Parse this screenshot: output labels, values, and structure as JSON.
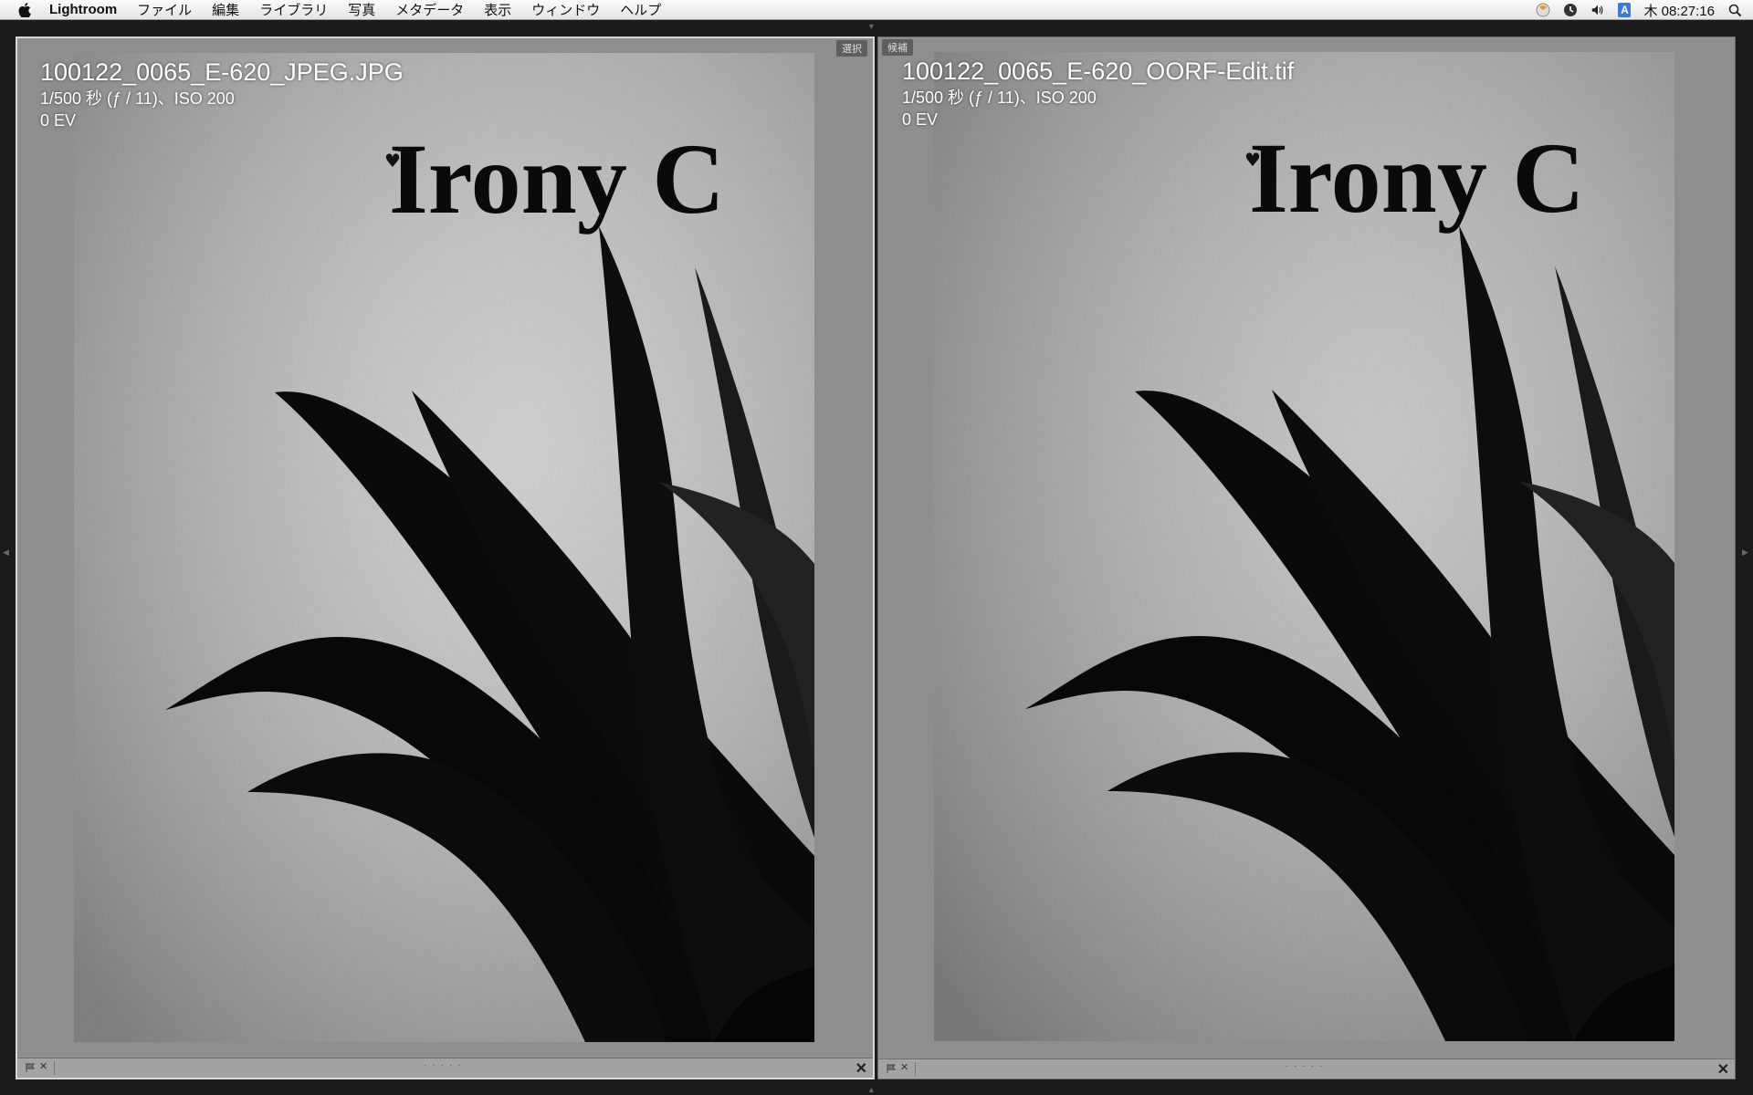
{
  "menubar": {
    "app_name": "Lightroom",
    "items": [
      "ファイル",
      "編集",
      "ライブラリ",
      "写真",
      "メタデータ",
      "表示",
      "ウィンドウ",
      "ヘルプ"
    ],
    "ime_label": "A",
    "clock": "木 08:27:16"
  },
  "compare": {
    "left": {
      "tag": "選択",
      "filename": "100122_0065_E-620_JPEG.JPG",
      "exposure": "1/500 秒 (ƒ / 11)、ISO 200",
      "ev": "0 EV"
    },
    "right": {
      "tag": "候補",
      "filename": "100122_0065_E-620_OORF-Edit.tif",
      "exposure": "1/500 秒 (ƒ / 11)、ISO 200",
      "ev": "0 EV"
    }
  },
  "photo": {
    "sign_text": "Irony C",
    "left_bg": "#c4c4c4",
    "right_bg": "#b7b7b7"
  }
}
